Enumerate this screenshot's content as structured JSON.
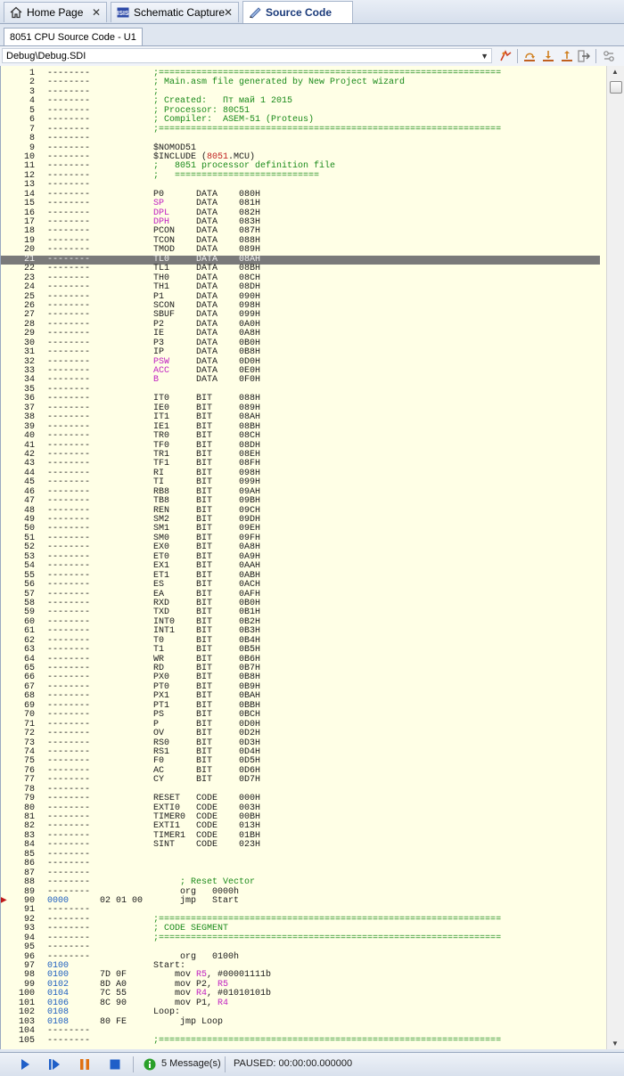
{
  "tabs": [
    {
      "label": "Home Page",
      "icon": "home-icon"
    },
    {
      "label": "Schematic Capture",
      "icon": "schematic-icon"
    },
    {
      "label": "Source Code",
      "icon": "source-code-icon"
    }
  ],
  "doc_tab": "8051 CPU Source Code - U1",
  "toolbar": {
    "file_select": "Debug\\Debug.SDI"
  },
  "code_lines": [
    {
      "ln": "1",
      "addr": "--------",
      "ob": "",
      "src": ";================================================================",
      "cls": "cm"
    },
    {
      "ln": "2",
      "addr": "--------",
      "ob": "",
      "src": "; Main.asm file generated by New Project wizard",
      "cls": "cm"
    },
    {
      "ln": "3",
      "addr": "--------",
      "ob": "",
      "src": ";",
      "cls": "cm"
    },
    {
      "ln": "4",
      "addr": "--------",
      "ob": "",
      "src": "; Created:   Пт май 1 2015",
      "cls": "cm"
    },
    {
      "ln": "5",
      "addr": "--------",
      "ob": "",
      "src": "; Processor: 80C51",
      "cls": "cm"
    },
    {
      "ln": "6",
      "addr": "--------",
      "ob": "",
      "src": "; Compiler:  ASEM-51 (Proteus)",
      "cls": "cm"
    },
    {
      "ln": "7",
      "addr": "--------",
      "ob": "",
      "src": ";================================================================",
      "cls": "cm"
    },
    {
      "ln": "8",
      "addr": "--------",
      "ob": "",
      "src": "",
      "cls": ""
    },
    {
      "ln": "9",
      "addr": "--------",
      "ob": "",
      "src": "$NOMOD51",
      "cls": ""
    },
    {
      "ln": "10",
      "addr": "--------",
      "ob": "",
      "src": "$INCLUDE (8051.MCU)",
      "cls": "inc"
    },
    {
      "ln": "11",
      "addr": "--------",
      "ob": "",
      "src": ";   8051 processor definition file",
      "cls": "cm"
    },
    {
      "ln": "12",
      "addr": "--------",
      "ob": "",
      "src": ";   ===========================",
      "cls": "cm"
    },
    {
      "ln": "13",
      "addr": "--------",
      "ob": "",
      "src": "",
      "cls": ""
    },
    {
      "ln": "14",
      "addr": "--------",
      "ob": "",
      "src": "P0      DATA    080H",
      "cls": ""
    },
    {
      "ln": "15",
      "addr": "--------",
      "ob": "",
      "src": "SP      DATA    081H",
      "cls": "k1"
    },
    {
      "ln": "16",
      "addr": "--------",
      "ob": "",
      "src": "DPL     DATA    082H",
      "cls": "k1"
    },
    {
      "ln": "17",
      "addr": "--------",
      "ob": "",
      "src": "DPH     DATA    083H",
      "cls": "k1"
    },
    {
      "ln": "18",
      "addr": "--------",
      "ob": "",
      "src": "PCON    DATA    087H",
      "cls": ""
    },
    {
      "ln": "19",
      "addr": "--------",
      "ob": "",
      "src": "TCON    DATA    088H",
      "cls": ""
    },
    {
      "ln": "20",
      "addr": "--------",
      "ob": "",
      "src": "TMOD    DATA    089H",
      "cls": ""
    },
    {
      "ln": "21",
      "addr": "--------",
      "ob": "",
      "src": "TL0     DATA    08AH",
      "cls": "hl"
    },
    {
      "ln": "22",
      "addr": "--------",
      "ob": "",
      "src": "TL1     DATA    08BH",
      "cls": ""
    },
    {
      "ln": "23",
      "addr": "--------",
      "ob": "",
      "src": "TH0     DATA    08CH",
      "cls": ""
    },
    {
      "ln": "24",
      "addr": "--------",
      "ob": "",
      "src": "TH1     DATA    08DH",
      "cls": ""
    },
    {
      "ln": "25",
      "addr": "--------",
      "ob": "",
      "src": "P1      DATA    090H",
      "cls": ""
    },
    {
      "ln": "26",
      "addr": "--------",
      "ob": "",
      "src": "SCON    DATA    098H",
      "cls": ""
    },
    {
      "ln": "27",
      "addr": "--------",
      "ob": "",
      "src": "SBUF    DATA    099H",
      "cls": ""
    },
    {
      "ln": "28",
      "addr": "--------",
      "ob": "",
      "src": "P2      DATA    0A0H",
      "cls": ""
    },
    {
      "ln": "29",
      "addr": "--------",
      "ob": "",
      "src": "IE      DATA    0A8H",
      "cls": ""
    },
    {
      "ln": "30",
      "addr": "--------",
      "ob": "",
      "src": "P3      DATA    0B0H",
      "cls": ""
    },
    {
      "ln": "31",
      "addr": "--------",
      "ob": "",
      "src": "IP      DATA    0B8H",
      "cls": ""
    },
    {
      "ln": "32",
      "addr": "--------",
      "ob": "",
      "src": "PSW     DATA    0D0H",
      "cls": "k1"
    },
    {
      "ln": "33",
      "addr": "--------",
      "ob": "",
      "src": "ACC     DATA    0E0H",
      "cls": "k1"
    },
    {
      "ln": "34",
      "addr": "--------",
      "ob": "",
      "src": "B       DATA    0F0H",
      "cls": "k1"
    },
    {
      "ln": "35",
      "addr": "--------",
      "ob": "",
      "src": "",
      "cls": ""
    },
    {
      "ln": "36",
      "addr": "--------",
      "ob": "",
      "src": "IT0     BIT     088H",
      "cls": ""
    },
    {
      "ln": "37",
      "addr": "--------",
      "ob": "",
      "src": "IE0     BIT     089H",
      "cls": ""
    },
    {
      "ln": "38",
      "addr": "--------",
      "ob": "",
      "src": "IT1     BIT     08AH",
      "cls": ""
    },
    {
      "ln": "39",
      "addr": "--------",
      "ob": "",
      "src": "IE1     BIT     08BH",
      "cls": ""
    },
    {
      "ln": "40",
      "addr": "--------",
      "ob": "",
      "src": "TR0     BIT     08CH",
      "cls": ""
    },
    {
      "ln": "41",
      "addr": "--------",
      "ob": "",
      "src": "TF0     BIT     08DH",
      "cls": ""
    },
    {
      "ln": "42",
      "addr": "--------",
      "ob": "",
      "src": "TR1     BIT     08EH",
      "cls": ""
    },
    {
      "ln": "43",
      "addr": "--------",
      "ob": "",
      "src": "TF1     BIT     08FH",
      "cls": ""
    },
    {
      "ln": "44",
      "addr": "--------",
      "ob": "",
      "src": "RI      BIT     098H",
      "cls": ""
    },
    {
      "ln": "45",
      "addr": "--------",
      "ob": "",
      "src": "TI      BIT     099H",
      "cls": ""
    },
    {
      "ln": "46",
      "addr": "--------",
      "ob": "",
      "src": "RB8     BIT     09AH",
      "cls": ""
    },
    {
      "ln": "47",
      "addr": "--------",
      "ob": "",
      "src": "TB8     BIT     09BH",
      "cls": ""
    },
    {
      "ln": "48",
      "addr": "--------",
      "ob": "",
      "src": "REN     BIT     09CH",
      "cls": ""
    },
    {
      "ln": "49",
      "addr": "--------",
      "ob": "",
      "src": "SM2     BIT     09DH",
      "cls": ""
    },
    {
      "ln": "50",
      "addr": "--------",
      "ob": "",
      "src": "SM1     BIT     09EH",
      "cls": ""
    },
    {
      "ln": "51",
      "addr": "--------",
      "ob": "",
      "src": "SM0     BIT     09FH",
      "cls": ""
    },
    {
      "ln": "52",
      "addr": "--------",
      "ob": "",
      "src": "EX0     BIT     0A8H",
      "cls": ""
    },
    {
      "ln": "53",
      "addr": "--------",
      "ob": "",
      "src": "ET0     BIT     0A9H",
      "cls": ""
    },
    {
      "ln": "54",
      "addr": "--------",
      "ob": "",
      "src": "EX1     BIT     0AAH",
      "cls": ""
    },
    {
      "ln": "55",
      "addr": "--------",
      "ob": "",
      "src": "ET1     BIT     0ABH",
      "cls": ""
    },
    {
      "ln": "56",
      "addr": "--------",
      "ob": "",
      "src": "ES      BIT     0ACH",
      "cls": ""
    },
    {
      "ln": "57",
      "addr": "--------",
      "ob": "",
      "src": "EA      BIT     0AFH",
      "cls": ""
    },
    {
      "ln": "58",
      "addr": "--------",
      "ob": "",
      "src": "RXD     BIT     0B0H",
      "cls": ""
    },
    {
      "ln": "59",
      "addr": "--------",
      "ob": "",
      "src": "TXD     BIT     0B1H",
      "cls": ""
    },
    {
      "ln": "60",
      "addr": "--------",
      "ob": "",
      "src": "INT0    BIT     0B2H",
      "cls": ""
    },
    {
      "ln": "61",
      "addr": "--------",
      "ob": "",
      "src": "INT1    BIT     0B3H",
      "cls": ""
    },
    {
      "ln": "62",
      "addr": "--------",
      "ob": "",
      "src": "T0      BIT     0B4H",
      "cls": ""
    },
    {
      "ln": "63",
      "addr": "--------",
      "ob": "",
      "src": "T1      BIT     0B5H",
      "cls": ""
    },
    {
      "ln": "64",
      "addr": "--------",
      "ob": "",
      "src": "WR      BIT     0B6H",
      "cls": ""
    },
    {
      "ln": "65",
      "addr": "--------",
      "ob": "",
      "src": "RD      BIT     0B7H",
      "cls": ""
    },
    {
      "ln": "66",
      "addr": "--------",
      "ob": "",
      "src": "PX0     BIT     0B8H",
      "cls": ""
    },
    {
      "ln": "67",
      "addr": "--------",
      "ob": "",
      "src": "PT0     BIT     0B9H",
      "cls": ""
    },
    {
      "ln": "68",
      "addr": "--------",
      "ob": "",
      "src": "PX1     BIT     0BAH",
      "cls": ""
    },
    {
      "ln": "69",
      "addr": "--------",
      "ob": "",
      "src": "PT1     BIT     0BBH",
      "cls": ""
    },
    {
      "ln": "70",
      "addr": "--------",
      "ob": "",
      "src": "PS      BIT     0BCH",
      "cls": ""
    },
    {
      "ln": "71",
      "addr": "--------",
      "ob": "",
      "src": "P       BIT     0D0H",
      "cls": ""
    },
    {
      "ln": "72",
      "addr": "--------",
      "ob": "",
      "src": "OV      BIT     0D2H",
      "cls": ""
    },
    {
      "ln": "73",
      "addr": "--------",
      "ob": "",
      "src": "RS0     BIT     0D3H",
      "cls": ""
    },
    {
      "ln": "74",
      "addr": "--------",
      "ob": "",
      "src": "RS1     BIT     0D4H",
      "cls": ""
    },
    {
      "ln": "75",
      "addr": "--------",
      "ob": "",
      "src": "F0      BIT     0D5H",
      "cls": ""
    },
    {
      "ln": "76",
      "addr": "--------",
      "ob": "",
      "src": "AC      BIT     0D6H",
      "cls": ""
    },
    {
      "ln": "77",
      "addr": "--------",
      "ob": "",
      "src": "CY      BIT     0D7H",
      "cls": ""
    },
    {
      "ln": "78",
      "addr": "--------",
      "ob": "",
      "src": "",
      "cls": ""
    },
    {
      "ln": "79",
      "addr": "--------",
      "ob": "",
      "src": "RESET   CODE    000H",
      "cls": ""
    },
    {
      "ln": "80",
      "addr": "--------",
      "ob": "",
      "src": "EXTI0   CODE    003H",
      "cls": ""
    },
    {
      "ln": "81",
      "addr": "--------",
      "ob": "",
      "src": "TIMER0  CODE    00BH",
      "cls": ""
    },
    {
      "ln": "82",
      "addr": "--------",
      "ob": "",
      "src": "EXTI1   CODE    013H",
      "cls": ""
    },
    {
      "ln": "83",
      "addr": "--------",
      "ob": "",
      "src": "TIMER1  CODE    01BH",
      "cls": ""
    },
    {
      "ln": "84",
      "addr": "--------",
      "ob": "",
      "src": "SINT    CODE    023H",
      "cls": ""
    },
    {
      "ln": "85",
      "addr": "--------",
      "ob": "",
      "src": "",
      "cls": ""
    },
    {
      "ln": "86",
      "addr": "--------",
      "ob": "",
      "src": "",
      "cls": ""
    },
    {
      "ln": "87",
      "addr": "--------",
      "ob": "",
      "src": "",
      "cls": ""
    },
    {
      "ln": "88",
      "addr": "--------",
      "ob": "",
      "src": "     ; Reset Vector",
      "cls": "cm"
    },
    {
      "ln": "89",
      "addr": "--------",
      "ob": "",
      "src": "     org   0000h",
      "cls": ""
    },
    {
      "ln": "90",
      "addr": "0000",
      "ob": "02 01 00",
      "src": "     jmp   Start",
      "cls": "bp"
    },
    {
      "ln": "91",
      "addr": "--------",
      "ob": "",
      "src": "",
      "cls": ""
    },
    {
      "ln": "92",
      "addr": "--------",
      "ob": "",
      "src": ";================================================================",
      "cls": "cm"
    },
    {
      "ln": "93",
      "addr": "--------",
      "ob": "",
      "src": "; CODE SEGMENT",
      "cls": "cm"
    },
    {
      "ln": "94",
      "addr": "--------",
      "ob": "",
      "src": ";================================================================",
      "cls": "cm"
    },
    {
      "ln": "95",
      "addr": "--------",
      "ob": "",
      "src": "",
      "cls": ""
    },
    {
      "ln": "96",
      "addr": "--------",
      "ob": "",
      "src": "     org   0100h",
      "cls": ""
    },
    {
      "ln": "97",
      "addr": "0100",
      "ob": "",
      "src": "Start:",
      "cls": ""
    },
    {
      "ln": "98",
      "addr": "0100",
      "ob": "7D 0F",
      "src": "    mov R5, #00001111b",
      "cls": "r5"
    },
    {
      "ln": "99",
      "addr": "0102",
      "ob": "8D A0",
      "src": "    mov P2, R5",
      "cls": "r5b"
    },
    {
      "ln": "100",
      "addr": "0104",
      "ob": "7C 55",
      "src": "    mov R4, #01010101b",
      "cls": "r4"
    },
    {
      "ln": "101",
      "addr": "0106",
      "ob": "8C 90",
      "src": "    mov P1, R4",
      "cls": "r4b"
    },
    {
      "ln": "102",
      "addr": "0108",
      "ob": "",
      "src": "Loop:",
      "cls": ""
    },
    {
      "ln": "103",
      "addr": "0108",
      "ob": "80 FE",
      "src": "     jmp Loop",
      "cls": ""
    },
    {
      "ln": "104",
      "addr": "--------",
      "ob": "",
      "src": "",
      "cls": ""
    },
    {
      "ln": "105",
      "addr": "--------",
      "ob": "",
      "src": ";================================================================",
      "cls": "cm"
    }
  ],
  "status": {
    "messages": "5 Message(s)",
    "state": "PAUSED: 00:00:00.000000"
  },
  "colors": {
    "code_bg": "#ffffe6",
    "comment": "#1a8a1a",
    "keyword": "#c020c0",
    "address": "#2060c0",
    "highlight": "#7a7a7a"
  }
}
